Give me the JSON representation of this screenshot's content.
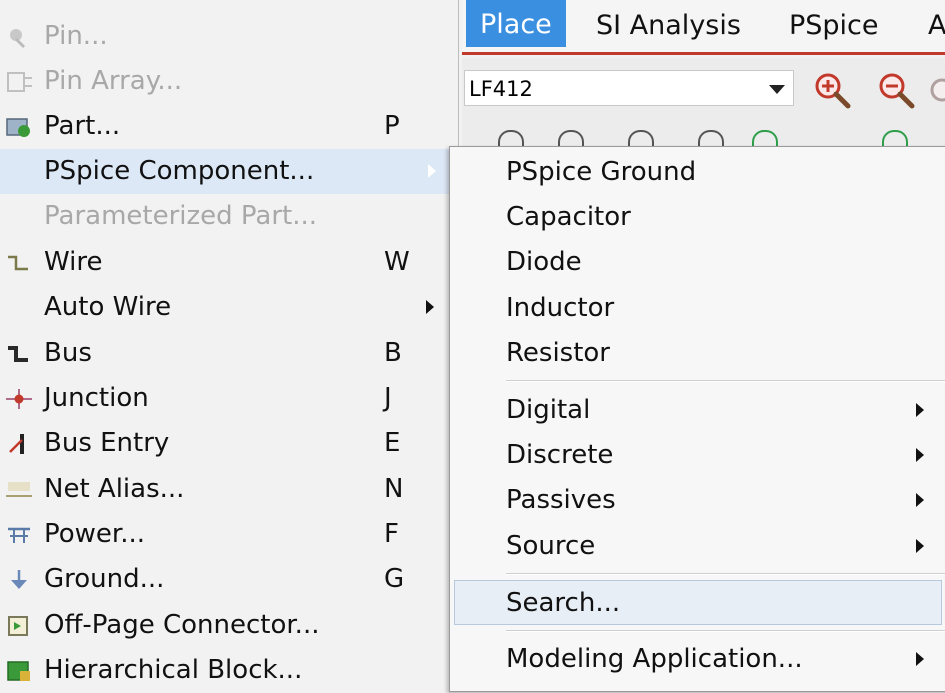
{
  "menubar": {
    "place": "Place",
    "si_analysis": "SI Analysis",
    "pspice": "PSpice",
    "next_partial": "A"
  },
  "toolbar": {
    "part_combo_value": "LF412"
  },
  "left_menu": {
    "items": [
      {
        "label": "Pin...",
        "shortcut": "",
        "icon": "pin-icon",
        "disabled": true
      },
      {
        "label": "Pin Array...",
        "shortcut": "",
        "icon": "pin-array-icon",
        "disabled": true
      },
      {
        "label": "Part...",
        "shortcut": "P",
        "icon": "part-icon"
      },
      {
        "label": "PSpice Component...",
        "shortcut": "",
        "icon": "",
        "highlighted": true,
        "submenu": true
      },
      {
        "label": "Parameterized Part...",
        "shortcut": "",
        "icon": "",
        "disabled": true
      },
      {
        "label": "Wire",
        "shortcut": "W",
        "icon": "wire-icon"
      },
      {
        "label": "Auto Wire",
        "shortcut": "",
        "icon": "",
        "submenu": true
      },
      {
        "label": "Bus",
        "shortcut": "B",
        "icon": "bus-icon"
      },
      {
        "label": "Junction",
        "shortcut": "J",
        "icon": "junction-icon"
      },
      {
        "label": "Bus Entry",
        "shortcut": "E",
        "icon": "bus-entry-icon"
      },
      {
        "label": "Net Alias...",
        "shortcut": "N",
        "icon": "net-alias-icon"
      },
      {
        "label": "Power...",
        "shortcut": "F",
        "icon": "power-icon"
      },
      {
        "label": "Ground...",
        "shortcut": "G",
        "icon": "ground-icon"
      },
      {
        "label": "Off-Page Connector...",
        "shortcut": "",
        "icon": "off-page-connector-icon"
      },
      {
        "label": "Hierarchical Block...",
        "shortcut": "",
        "icon": "hierarchical-block-icon"
      }
    ]
  },
  "submenu": {
    "items": [
      {
        "label": "PSpice Ground"
      },
      {
        "label": "Capacitor"
      },
      {
        "label": "Diode"
      },
      {
        "label": "Inductor"
      },
      {
        "label": "Resistor"
      },
      {
        "label": "Digital",
        "submenu": true
      },
      {
        "label": "Discrete",
        "submenu": true
      },
      {
        "label": "Passives",
        "submenu": true
      },
      {
        "label": "Source",
        "submenu": true
      },
      {
        "label": "Search...",
        "highlighted": true
      },
      {
        "label": "Modeling Application...",
        "submenu": true
      }
    ]
  },
  "colors": {
    "menu_bg": "#f2f2f2",
    "highlight": "#dde8f6",
    "active_menu": "#3b8fe0",
    "menubar_rule": "#c0392b",
    "disabled_text": "#a8a8a8"
  }
}
